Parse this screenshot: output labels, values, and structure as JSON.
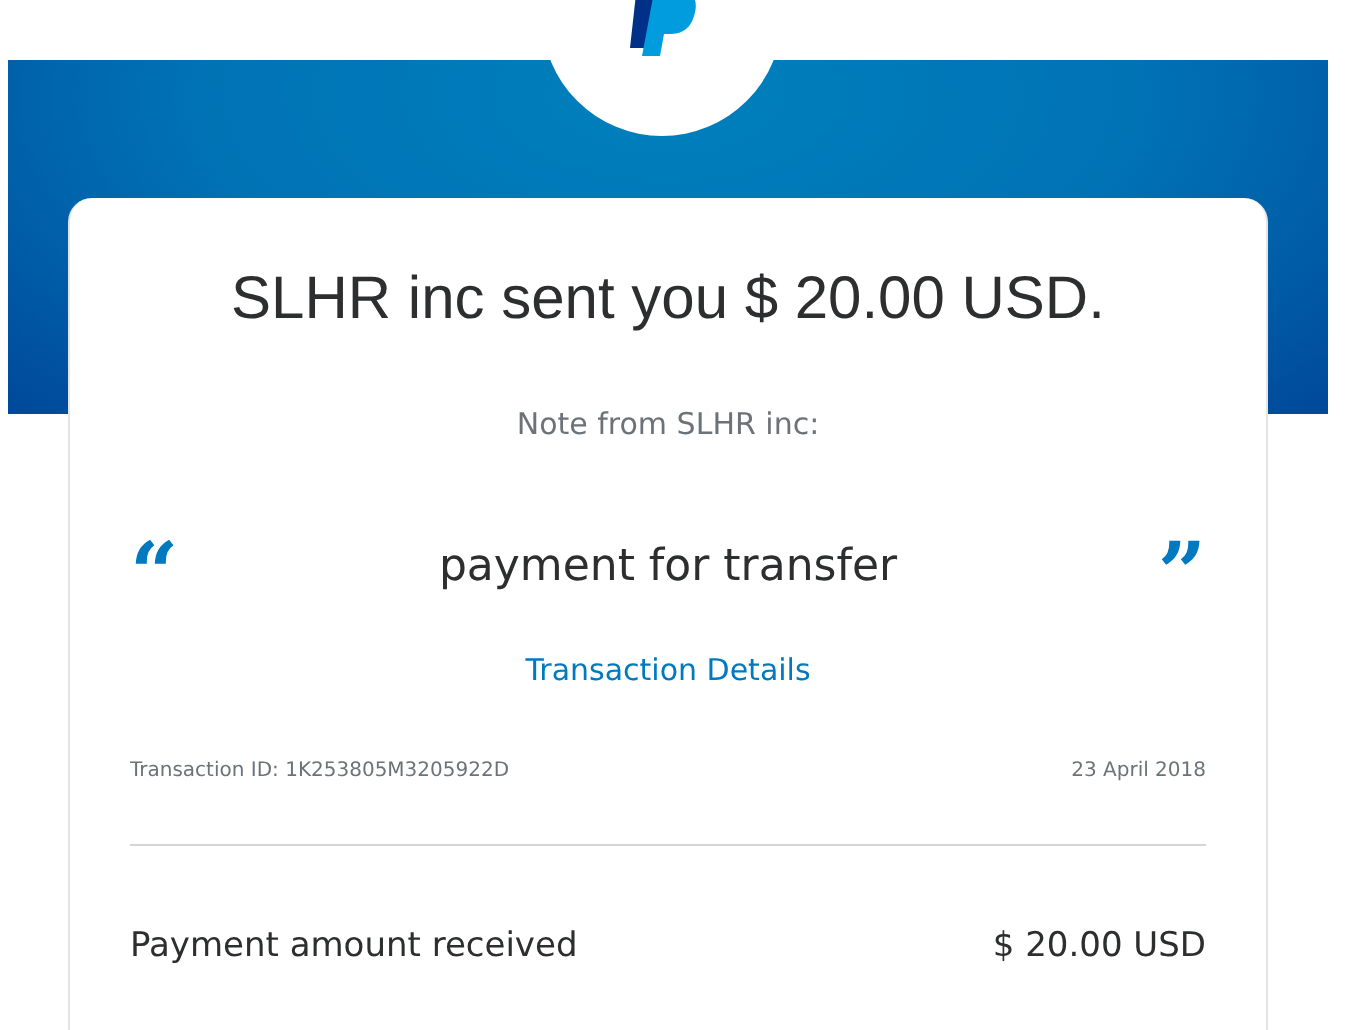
{
  "header": {
    "kind": "logo"
  },
  "card": {
    "title": "SLHR inc sent you $ 20.00 USD.",
    "note_label": "Note from SLHR inc:",
    "note": {
      "open_quote": "“",
      "text": "payment for transfer",
      "close_quote": "”"
    },
    "details_link": "Transaction Details",
    "transaction_id": "Transaction ID: 1K253805M3205922D",
    "date": "23 April 2018",
    "summary": [
      {
        "label": "Payment amount received",
        "value": "$ 20.00 USD"
      }
    ]
  }
}
